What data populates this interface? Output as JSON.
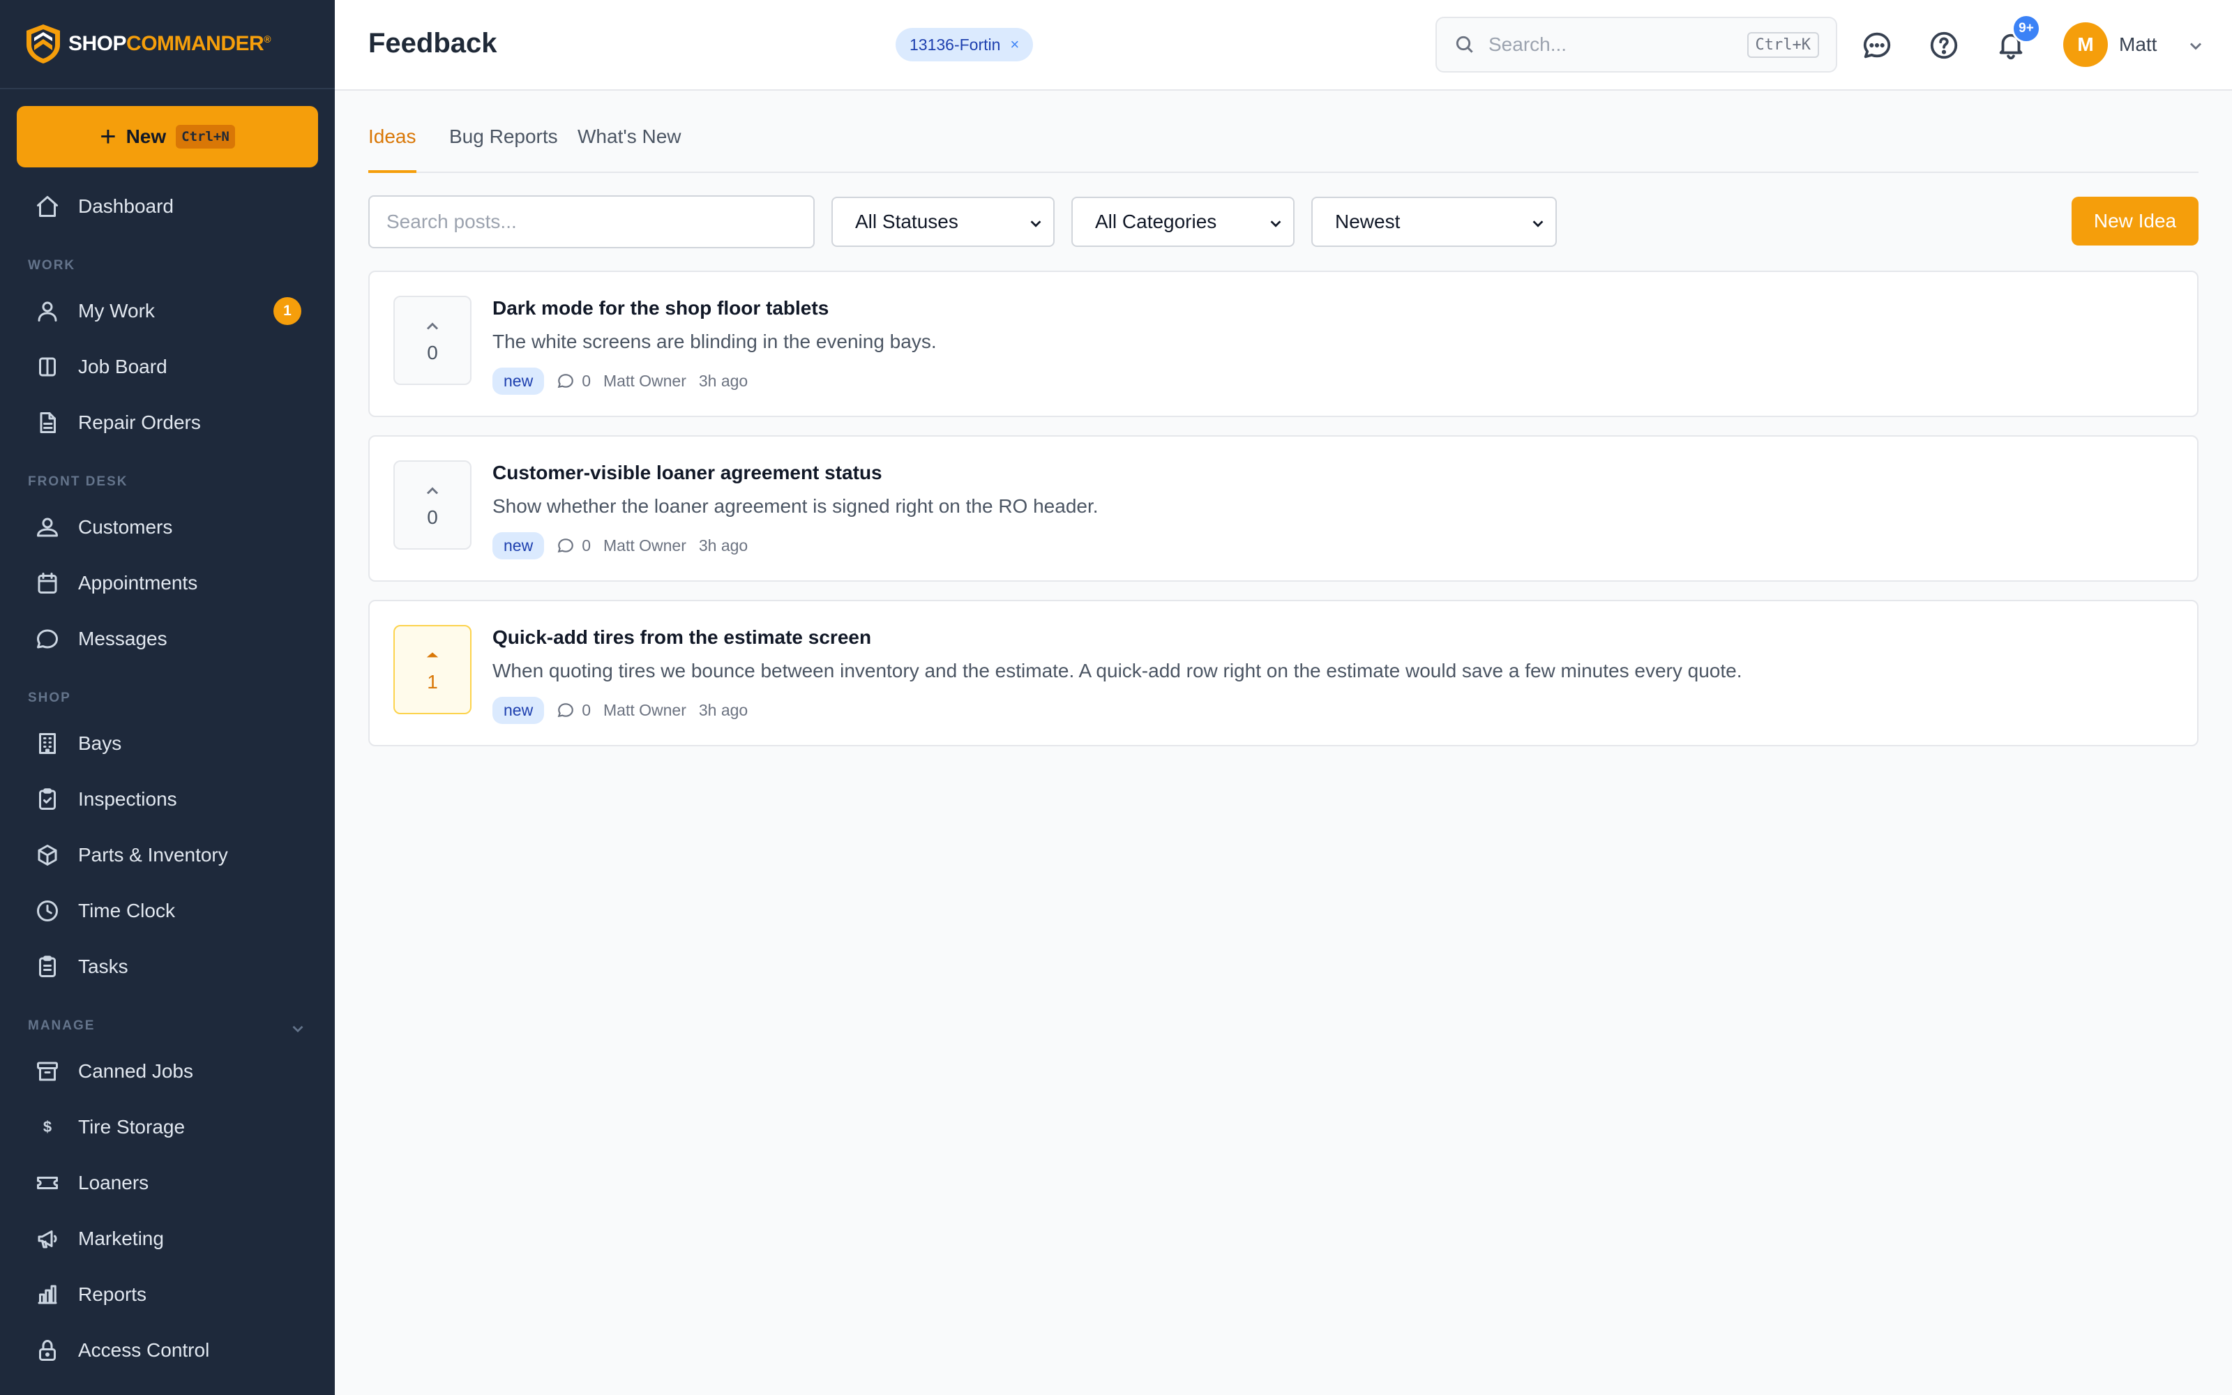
{
  "brand": {
    "name_part1": "SHOP",
    "name_part2": "COMMANDER",
    "mark": "®"
  },
  "sidebar": {
    "new_button": {
      "label": "New",
      "shortcut": "Ctrl+N"
    },
    "dashboard": "Dashboard",
    "sections": {
      "work": "WORK",
      "front_desk": "FRONT DESK",
      "shop": "SHOP",
      "manage": "MANAGE"
    },
    "work_items": [
      {
        "label": "My Work",
        "icon": "user-icon",
        "badge": "1"
      },
      {
        "label": "Job Board",
        "icon": "columns-icon"
      },
      {
        "label": "Repair Orders",
        "icon": "document-icon"
      }
    ],
    "front_desk_items": [
      {
        "label": "Customers",
        "icon": "users-icon"
      },
      {
        "label": "Appointments",
        "icon": "calendar-icon"
      },
      {
        "label": "Messages",
        "icon": "chat-icon"
      }
    ],
    "shop_items": [
      {
        "label": "Bays",
        "icon": "building-icon"
      },
      {
        "label": "Inspections",
        "icon": "clipboard-check-icon"
      },
      {
        "label": "Parts & Inventory",
        "icon": "box-icon"
      },
      {
        "label": "Time Clock",
        "icon": "clock-icon"
      },
      {
        "label": "Tasks",
        "icon": "clipboard-list-icon"
      }
    ],
    "manage_items": [
      {
        "label": "Canned Jobs",
        "icon": "archive-icon"
      },
      {
        "label": "Tire Storage",
        "icon": "dollar-icon",
        "glyph": "$"
      },
      {
        "label": "Loaners",
        "icon": "ticket-icon"
      },
      {
        "label": "Marketing",
        "icon": "megaphone-icon"
      },
      {
        "label": "Reports",
        "icon": "bar-chart-icon"
      },
      {
        "label": "Access Control",
        "icon": "lock-icon"
      }
    ]
  },
  "header": {
    "title": "Feedback",
    "chip": {
      "label": "13136-Fortin",
      "close": "×"
    },
    "search": {
      "placeholder": "Search...",
      "shortcut": "Ctrl+K"
    },
    "notifications_badge": "9+",
    "user": {
      "initial": "M",
      "name": "Matt"
    }
  },
  "main": {
    "tabs": [
      {
        "label": "Ideas",
        "active": true
      },
      {
        "label": "Bug Reports",
        "active": false
      },
      {
        "label": "What's New",
        "active": false
      }
    ],
    "filters": {
      "search_placeholder": "Search posts...",
      "status": "All Statuses",
      "category": "All Categories",
      "sort": "Newest",
      "new_button": "New Idea"
    },
    "posts": [
      {
        "votes": "0",
        "voted": false,
        "title": "Dark mode for the shop floor tablets",
        "description": "The white screens are blinding in the evening bays.",
        "status": "new",
        "comments": "0",
        "author": "Matt Owner",
        "time": "3h ago"
      },
      {
        "votes": "0",
        "voted": false,
        "title": "Customer-visible loaner agreement status",
        "description": "Show whether the loaner agreement is signed right on the RO header.",
        "status": "new",
        "comments": "0",
        "author": "Matt Owner",
        "time": "3h ago"
      },
      {
        "votes": "1",
        "voted": true,
        "title": "Quick-add tires from the estimate screen",
        "description": "When quoting tires we bounce between inventory and the estimate. A quick-add row right on the estimate would save a few minutes every quote.",
        "status": "new",
        "comments": "0",
        "author": "Matt Owner",
        "time": "3h ago"
      }
    ]
  },
  "colors": {
    "accent": "#f59e0b",
    "sidebar_bg": "#1e293b",
    "chip_bg": "#dbeafe",
    "badge_blue": "#3b82f6"
  }
}
